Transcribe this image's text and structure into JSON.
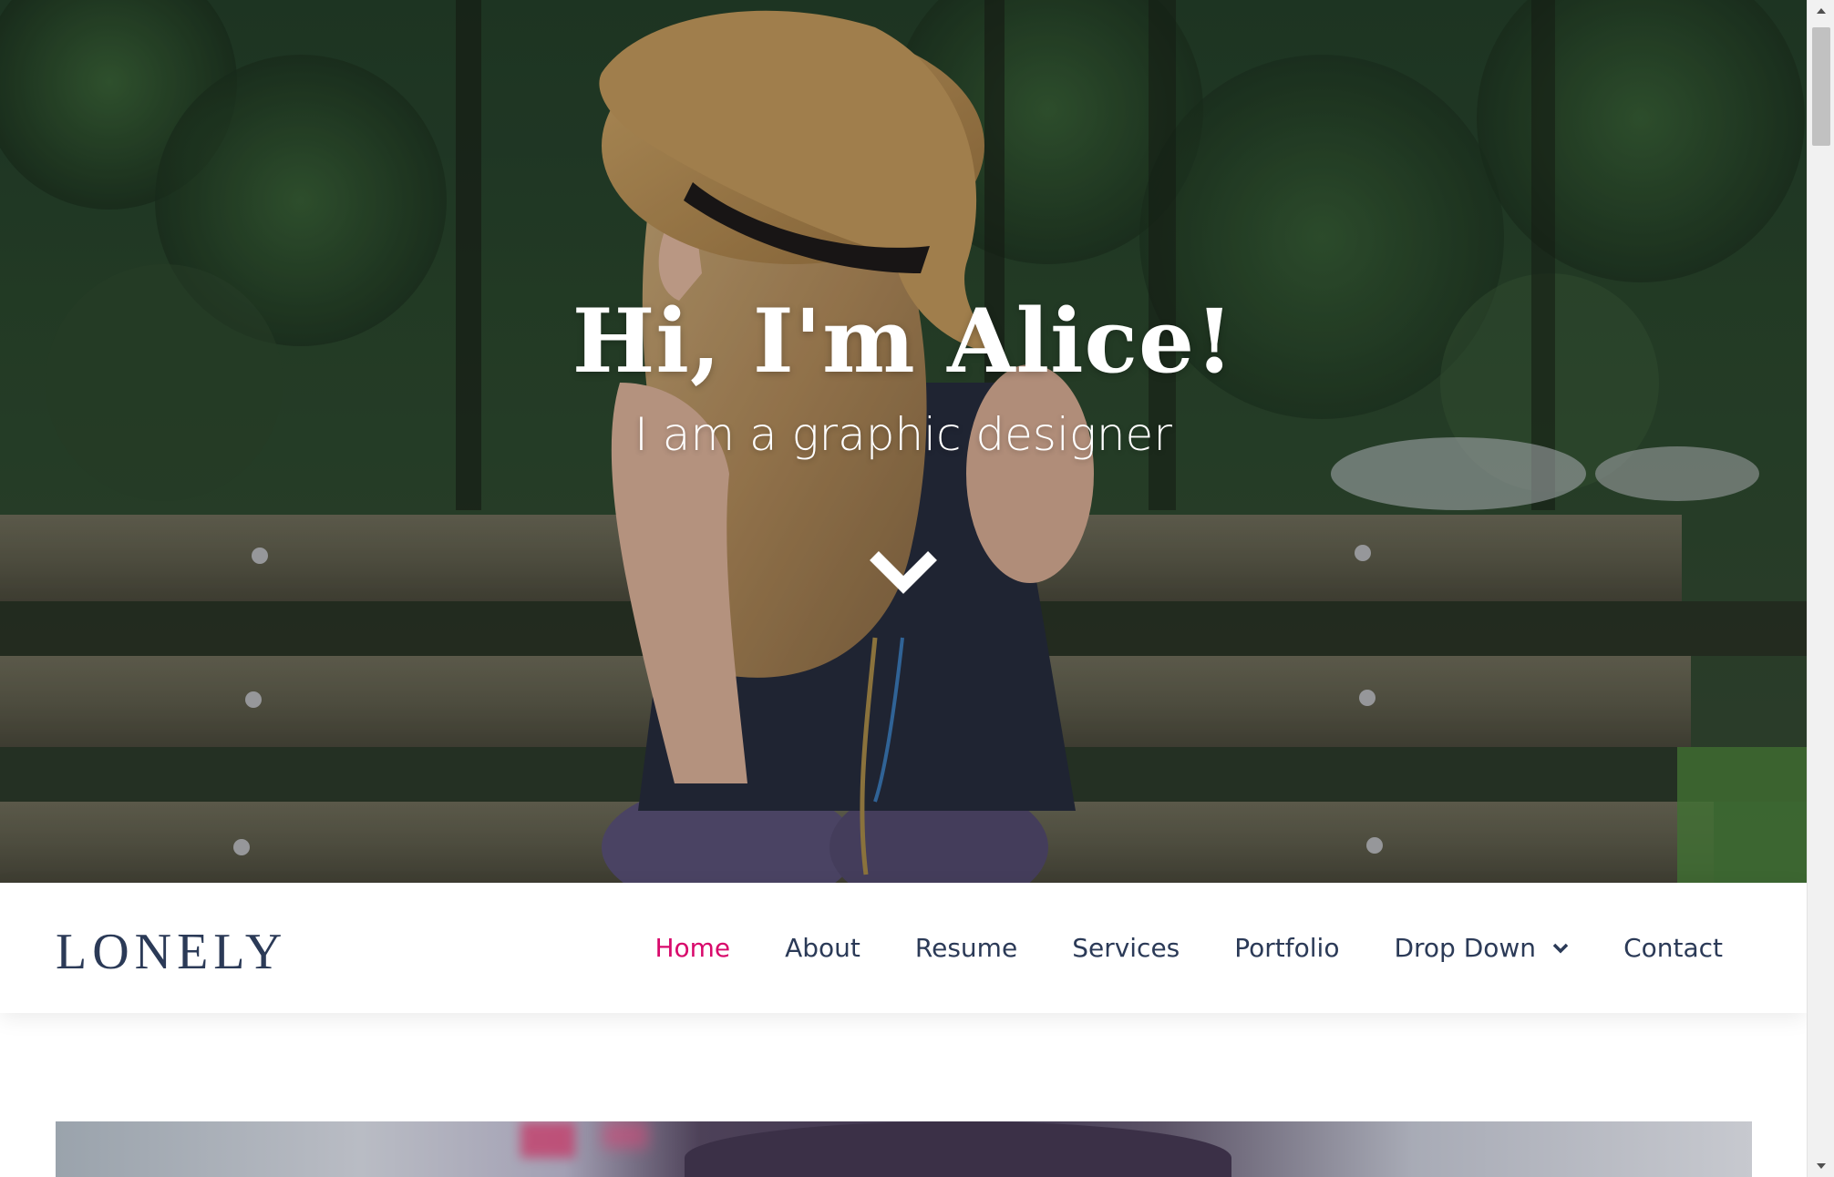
{
  "hero": {
    "title": "Hi, I'm Alice!",
    "subtitle": "I am a graphic designer",
    "scroll_icon": "chevron-down-icon"
  },
  "header": {
    "logo": "LONELY",
    "nav": [
      {
        "label": "Home",
        "active": true
      },
      {
        "label": "About",
        "active": false
      },
      {
        "label": "Resume",
        "active": false
      },
      {
        "label": "Services",
        "active": false
      },
      {
        "label": "Portfolio",
        "active": false
      },
      {
        "label": "Drop Down",
        "active": false,
        "has_dropdown": true
      },
      {
        "label": "Contact",
        "active": false
      }
    ]
  },
  "colors": {
    "accent": "#d8096b",
    "nav_text": "#2b3a57",
    "header_bg": "#ffffff"
  }
}
